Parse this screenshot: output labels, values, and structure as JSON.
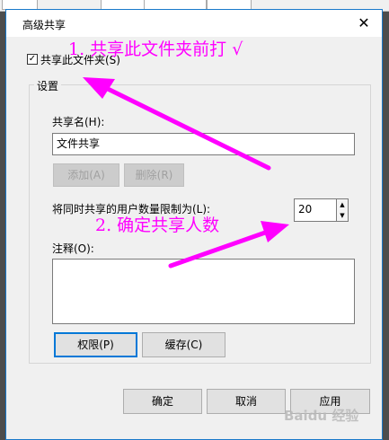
{
  "dialog": {
    "title": "高级共享",
    "close_glyph": "✕",
    "share_checkbox_label": "共享此文件夹(S)",
    "share_checkbox_checked": true,
    "group_label": "设置",
    "share_name_label": "共享名(H):",
    "share_name_value": "文件共享",
    "add_button": "添加(A)",
    "delete_button": "删除(R)",
    "user_limit_label": "将同时共享的用户数量限制为(L):",
    "user_limit_value": "20",
    "comments_label": "注释(O):",
    "comments_value": "",
    "permissions_button": "权限(P)",
    "caching_button": "缓存(C)",
    "ok_button": "确定",
    "cancel_button": "取消",
    "apply_button": "应用"
  },
  "annotations": {
    "note_1": "1. 共享此文件夹前打 √",
    "note_2": "2. 确定共享人数",
    "color": "#ff00ff"
  },
  "watermark": "Baidu 经验"
}
